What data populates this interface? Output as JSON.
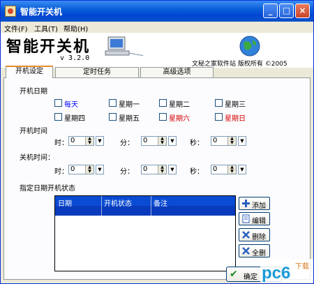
{
  "window": {
    "title": "智能开关机",
    "controls": {
      "minimize": "_",
      "maximize": "□",
      "close": "×"
    }
  },
  "menu": [
    {
      "label": "文件(F)"
    },
    {
      "label": "工具(T)"
    },
    {
      "label": "帮助(H)"
    }
  ],
  "banner": {
    "title": "智能开关机",
    "version": "v 3.2.0",
    "copyright": "文秘之家软件站  版权所有  ©2005"
  },
  "tabs": [
    {
      "label": "开机设定",
      "active": true
    },
    {
      "label": "定时任务",
      "active": false
    },
    {
      "label": "高级选项",
      "active": false
    }
  ],
  "boot_date": {
    "label": "开机日期",
    "days": [
      {
        "label": "每天",
        "color": "blue"
      },
      {
        "label": "星期一",
        "color": "black"
      },
      {
        "label": "星期二",
        "color": "black"
      },
      {
        "label": "星期三",
        "color": "black"
      },
      {
        "label": "星期四",
        "color": "black"
      },
      {
        "label": "星期五",
        "color": "black"
      },
      {
        "label": "星期六",
        "color": "red"
      },
      {
        "label": "星期日",
        "color": "red"
      }
    ]
  },
  "boot_time": {
    "label": "开机时间",
    "hour_label": "时：",
    "minute_label": "分：",
    "second_label": "秒：",
    "hour": "0",
    "minute": "0",
    "second": "0"
  },
  "shutdown_time": {
    "label": "关机时间：",
    "hour_label": "时：",
    "minute_label": "分：",
    "second_label": "秒：",
    "hour": "0",
    "minute": "0",
    "second": "0"
  },
  "date_boot_status": {
    "label": "指定日期开机状态",
    "columns": [
      "日期",
      "开机状态",
      "备注"
    ]
  },
  "side_buttons": [
    {
      "label": "添加",
      "icon": "add-icon"
    },
    {
      "label": "编辑",
      "icon": "edit-icon"
    },
    {
      "label": "删除",
      "icon": "delete-icon"
    },
    {
      "label": "全删",
      "icon": "delete-all-icon"
    }
  ],
  "ok_button": {
    "label": "确定"
  },
  "watermark": {
    "text": "下载",
    "site": "pc6"
  },
  "colors": {
    "title_bar": "#0a53c9",
    "tab_accent": "#e68b2c",
    "grid_header": "#0a4bd3",
    "weekday_blue": "#0000ff",
    "weekend_red": "#d40000"
  }
}
